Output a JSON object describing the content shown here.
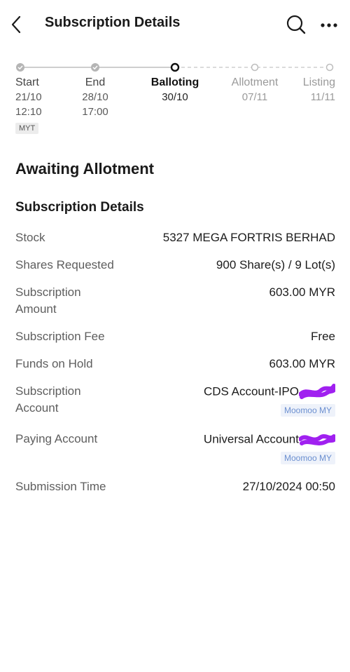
{
  "header": {
    "title": "Subscription Details",
    "back_icon": "chevron-left-icon",
    "search_icon": "search-icon",
    "more_icon": "more-horizontal-icon"
  },
  "timeline": {
    "steps": [
      {
        "name": "Start",
        "date": "21/10",
        "time": "12:10",
        "state": "done"
      },
      {
        "name": "End",
        "date": "28/10",
        "time": "17:00",
        "state": "done"
      },
      {
        "name": "Balloting",
        "date": "30/10",
        "state": "current"
      },
      {
        "name": "Allotment",
        "date": "07/11",
        "state": "future"
      },
      {
        "name": "Listing",
        "date": "11/11",
        "state": "future"
      }
    ],
    "timezone": "MYT"
  },
  "status": "Awaiting Allotment",
  "section_title": "Subscription Details",
  "details": {
    "stock": {
      "label": "Stock",
      "value": "5327 MEGA FORTRIS BERHAD"
    },
    "shares_requested": {
      "label": "Shares Requested",
      "value": "900 Share(s) / 9 Lot(s)"
    },
    "subscription_amount": {
      "label": "Subscription Amount",
      "value": "603.00 MYR"
    },
    "subscription_fee": {
      "label": "Subscription Fee",
      "value": "Free"
    },
    "funds_on_hold": {
      "label": "Funds on Hold",
      "value": "603.00 MYR"
    },
    "subscription_account": {
      "label": "Subscription Account",
      "value": "CDS Account-IPO",
      "tag": "Moomoo MY"
    },
    "paying_account": {
      "label": "Paying Account",
      "value": "Universal Account",
      "tag": "Moomoo MY"
    },
    "submission_time": {
      "label": "Submission Time",
      "value": "27/10/2024 00:50"
    }
  },
  "colors": {
    "accent_tag_text": "#6b8fd0",
    "redaction": "#a020f0",
    "done_dot": "#b5b5b5"
  }
}
